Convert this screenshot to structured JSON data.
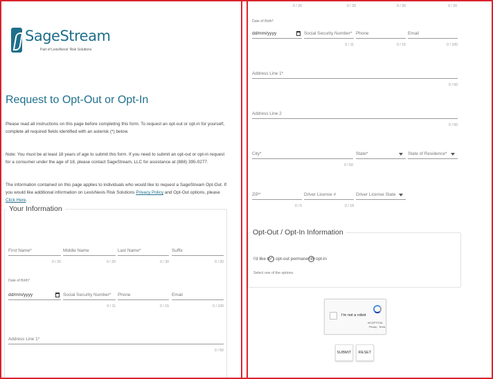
{
  "logo": {
    "name": "SageStream",
    "tagline": "Part of LexisNexis' Risk Solutions"
  },
  "page_title": "Request to Opt-Out or Opt-In",
  "intro": {
    "p1": "Please read all instructions on this page before completing this form. To request an opt-out or opt-in for yourself, complete all required fields identified with an asterisk (*) below.",
    "p2": "Note: You must be at least 18 years of age to submit this form. If you need to submit an opt-out or opt-in request for a consumer under the age of 18, please contact SageStream, LLC for assistance at (888) 395-0277.",
    "p3_prefix": "The information contained on this page applies to individuals who would like to request a SageStream Opt-Out. If you would like additional information on LexisNexis Risk Solutions ",
    "privacy_link": "Privacy Policy",
    "p3_mid": " and Opt-Out options, please ",
    "click_link": "Click Here",
    "p3_suffix": "."
  },
  "your_info": {
    "legend": "Your Information",
    "first_name": "First Name*",
    "first_name_count": "0 / 20",
    "middle_name": "Middle Name",
    "middle_name_count": "0 / 20",
    "last_name": "Last Name*",
    "last_name_count": "0 / 30",
    "suffix": "Suffix",
    "suffix_count": "0 / 20",
    "dob_label": "Date of Birth*",
    "dob_value": "dd/mm/yyyy",
    "ssn": "Social Security Number*",
    "ssn_count": "0 / 11",
    "phone": "Phone",
    "phone_count": "0 / 15",
    "email": "Email",
    "email_count": "0 / 100",
    "address1": "Address Line 1*",
    "address1_count": "0 / 50"
  },
  "right": {
    "top_counts": [
      "0 / 20",
      "0 / 20",
      "0 / 30",
      "0 / 20"
    ],
    "dob_label": "Date of Birth*",
    "dob_value": "dd/mm/yyyy",
    "ssn": "Social Security Number*",
    "ssn_count": "0 / 11",
    "phone": "Phone",
    "phone_count": "0 / 15",
    "email": "Email",
    "email_count": "0 / 100",
    "address1": "Address Line 1*",
    "address1_count": "0 / 50",
    "address2": "Address Line 2",
    "address2_count": "0 / 50",
    "city": "City*",
    "city_count": "0 / 50",
    "state": "State*",
    "state_residence": "State of Residence*",
    "zip": "ZIP*",
    "zip_count": "0 / 5",
    "license": "Driver License #",
    "license_count": "0 / 18",
    "license_state": "Driver License State"
  },
  "opt": {
    "legend": "Opt-Out / Opt-In Information",
    "question": "I'd like to*:",
    "opt_out": "opt-out permanently",
    "opt_in": "opt-in",
    "help": "Select one of the options."
  },
  "captcha": {
    "label": "I'm not a robot",
    "brand": "reCAPTCHA",
    "terms": "Privacy - Terms"
  },
  "buttons": {
    "submit": "SUBMIT",
    "reset": "RESET"
  }
}
